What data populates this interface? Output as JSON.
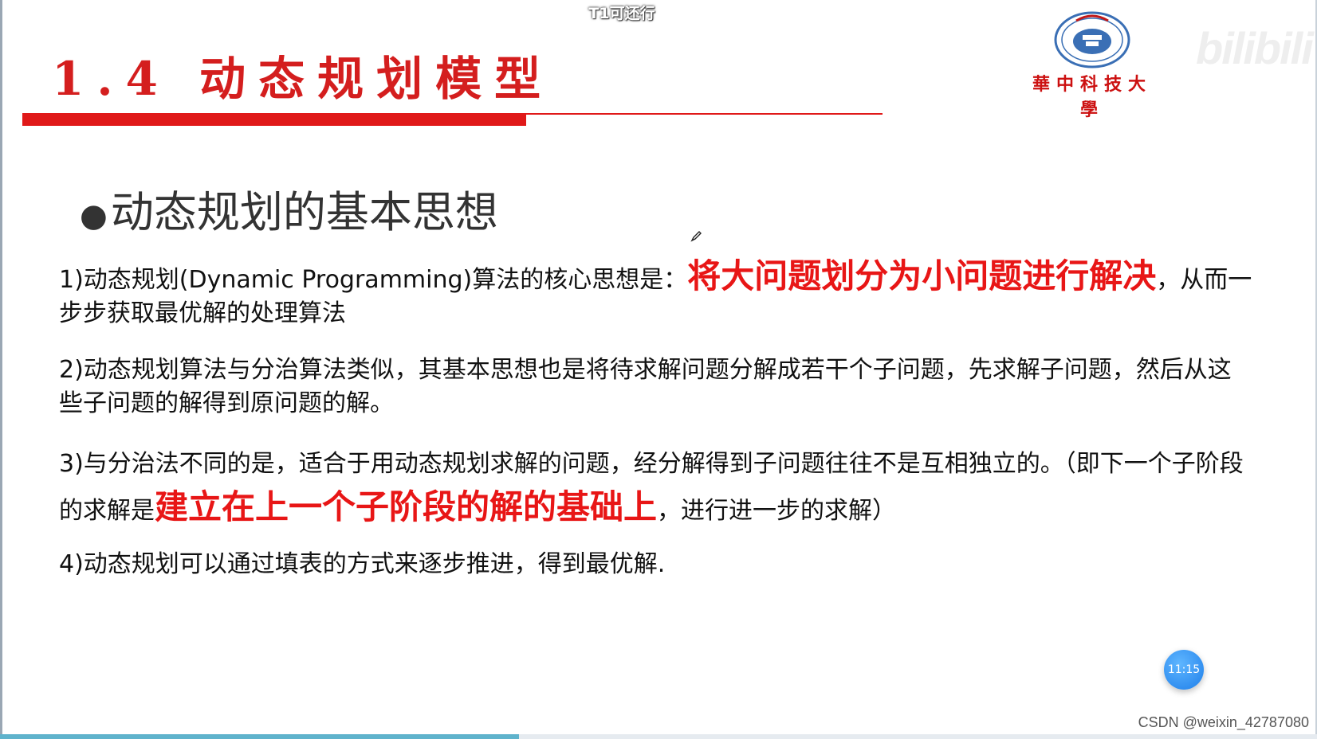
{
  "video": {
    "caption": "T1可还行",
    "progress_percent": 39.4,
    "timer": "11:15",
    "progress_color": "#5fb3cc"
  },
  "slide": {
    "title": "1.4 动态规划模型",
    "accent_color": "#e01919",
    "university_logo_text": "華中科技大學",
    "logo_icon": "hust-seal-icon",
    "section_heading": "动态规划的基本思想",
    "paragraphs": {
      "p1": {
        "prefix": "1)动态规划(Dynamic Programming)算法的核心思想是：",
        "highlight": "将大问题划分为小问题进行解决",
        "suffix": "，从而一步步获取最优解的处理算法"
      },
      "p2": {
        "text": "2)动态规划算法与分治算法类似，其基本思想也是将待求解问题分解成若干个子问题，先求解子问题，然后从这些子问题的解得到原问题的解。"
      },
      "p3": {
        "prefix": "3)与分治法不同的是，适合于用动态规划求解的问题，经分解得到子问题往往不是互相独立的。（即下一个子阶段的求解是",
        "highlight": "建立在上一个子阶段的解的基础上",
        "suffix": "，进行进一步的求解）"
      },
      "p4": {
        "text": "4)动态规划可以通过填表的方式来逐步推进，得到最优解."
      }
    }
  },
  "watermarks": {
    "bilibili": "bilibili",
    "csdn": "CSDN @weixin_42787080"
  }
}
